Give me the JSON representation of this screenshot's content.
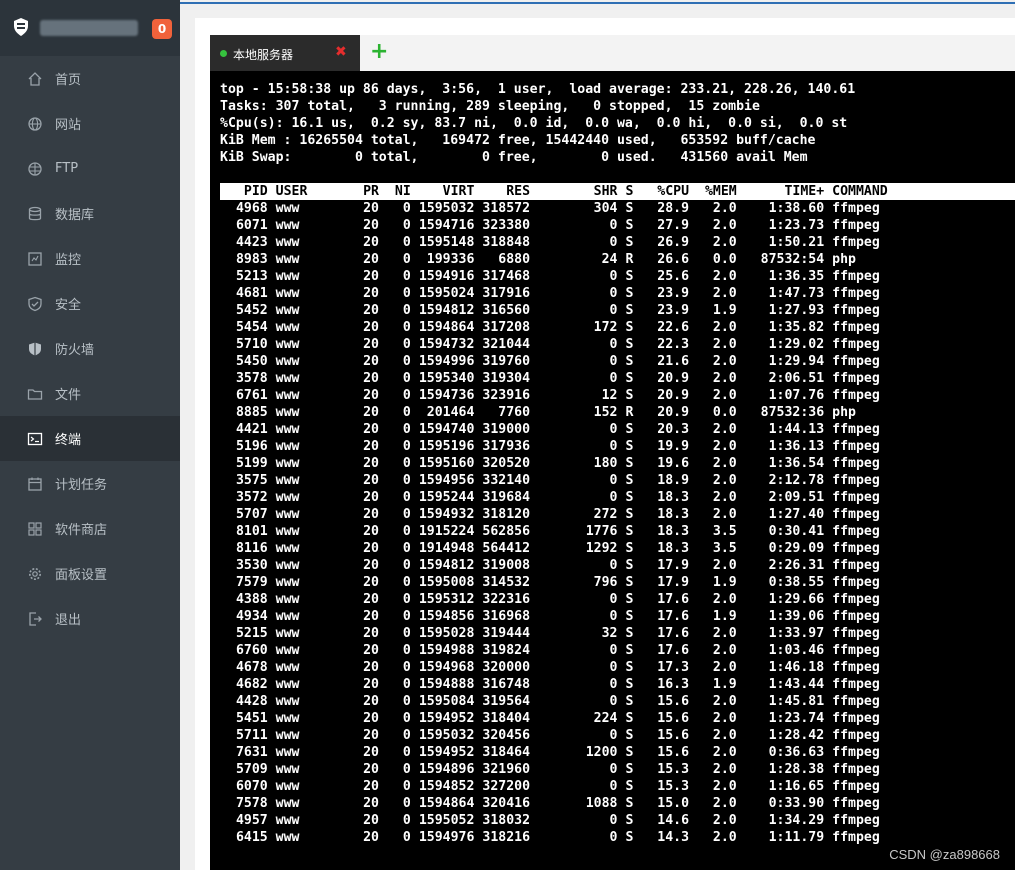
{
  "sidebar": {
    "badge": "0",
    "items": [
      {
        "label": "首页",
        "icon": "home-icon"
      },
      {
        "label": "网站",
        "icon": "globe-icon"
      },
      {
        "label": "FTP",
        "icon": "ftp-globe-icon"
      },
      {
        "label": "数据库",
        "icon": "database-icon"
      },
      {
        "label": "监控",
        "icon": "monitor-icon"
      },
      {
        "label": "安全",
        "icon": "shield-check-icon"
      },
      {
        "label": "防火墙",
        "icon": "firewall-icon"
      },
      {
        "label": "文件",
        "icon": "folder-icon"
      },
      {
        "label": "终端",
        "icon": "terminal-icon",
        "active": true
      },
      {
        "label": "计划任务",
        "icon": "calendar-icon"
      },
      {
        "label": "软件商店",
        "icon": "apps-icon"
      },
      {
        "label": "面板设置",
        "icon": "gear-icon"
      },
      {
        "label": "退出",
        "icon": "logout-icon"
      }
    ]
  },
  "tabs": {
    "active_label": "本地服务器",
    "close_symbol": "✖",
    "add_symbol": "+"
  },
  "terminal": {
    "summary": [
      "top - 15:58:38 up 86 days,  3:56,  1 user,  load average: 233.21, 228.26, 140.61",
      "Tasks: 307 total,   3 running, 289 sleeping,   0 stopped,  15 zombie",
      "%Cpu(s): 16.1 us,  0.2 sy, 83.7 ni,  0.0 id,  0.0 wa,  0.0 hi,  0.0 si,  0.0 st",
      "KiB Mem : 16265504 total,   169472 free, 15442440 used,   653592 buff/cache",
      "KiB Swap:        0 total,        0 free,        0 used.   431560 avail Mem"
    ],
    "columns": [
      "PID",
      "USER",
      "PR",
      "NI",
      "VIRT",
      "RES",
      "SHR",
      "S",
      "%CPU",
      "%MEM",
      "TIME+",
      "COMMAND"
    ],
    "processes": [
      [
        "4968",
        "www",
        "20",
        "0",
        "1595032",
        "318572",
        "304",
        "S",
        "28.9",
        "2.0",
        "1:38.60",
        "ffmpeg"
      ],
      [
        "6071",
        "www",
        "20",
        "0",
        "1594716",
        "323380",
        "0",
        "S",
        "27.9",
        "2.0",
        "1:23.73",
        "ffmpeg"
      ],
      [
        "4423",
        "www",
        "20",
        "0",
        "1595148",
        "318848",
        "0",
        "S",
        "26.9",
        "2.0",
        "1:50.21",
        "ffmpeg"
      ],
      [
        "8983",
        "www",
        "20",
        "0",
        "199336",
        "6880",
        "24",
        "R",
        "26.6",
        "0.0",
        "87532:54",
        "php"
      ],
      [
        "5213",
        "www",
        "20",
        "0",
        "1594916",
        "317468",
        "0",
        "S",
        "25.6",
        "2.0",
        "1:36.35",
        "ffmpeg"
      ],
      [
        "4681",
        "www",
        "20",
        "0",
        "1595024",
        "317916",
        "0",
        "S",
        "23.9",
        "2.0",
        "1:47.73",
        "ffmpeg"
      ],
      [
        "5452",
        "www",
        "20",
        "0",
        "1594812",
        "316560",
        "0",
        "S",
        "23.9",
        "1.9",
        "1:27.93",
        "ffmpeg"
      ],
      [
        "5454",
        "www",
        "20",
        "0",
        "1594864",
        "317208",
        "172",
        "S",
        "22.6",
        "2.0",
        "1:35.82",
        "ffmpeg"
      ],
      [
        "5710",
        "www",
        "20",
        "0",
        "1594732",
        "321044",
        "0",
        "S",
        "22.3",
        "2.0",
        "1:29.02",
        "ffmpeg"
      ],
      [
        "5450",
        "www",
        "20",
        "0",
        "1594996",
        "319760",
        "0",
        "S",
        "21.6",
        "2.0",
        "1:29.94",
        "ffmpeg"
      ],
      [
        "3578",
        "www",
        "20",
        "0",
        "1595340",
        "319304",
        "0",
        "S",
        "20.9",
        "2.0",
        "2:06.51",
        "ffmpeg"
      ],
      [
        "6761",
        "www",
        "20",
        "0",
        "1594736",
        "323916",
        "12",
        "S",
        "20.9",
        "2.0",
        "1:07.76",
        "ffmpeg"
      ],
      [
        "8885",
        "www",
        "20",
        "0",
        "201464",
        "7760",
        "152",
        "R",
        "20.9",
        "0.0",
        "87532:36",
        "php"
      ],
      [
        "4421",
        "www",
        "20",
        "0",
        "1594740",
        "319000",
        "0",
        "S",
        "20.3",
        "2.0",
        "1:44.13",
        "ffmpeg"
      ],
      [
        "5196",
        "www",
        "20",
        "0",
        "1595196",
        "317936",
        "0",
        "S",
        "19.9",
        "2.0",
        "1:36.13",
        "ffmpeg"
      ],
      [
        "5199",
        "www",
        "20",
        "0",
        "1595160",
        "320520",
        "180",
        "S",
        "19.6",
        "2.0",
        "1:36.54",
        "ffmpeg"
      ],
      [
        "3575",
        "www",
        "20",
        "0",
        "1594956",
        "332140",
        "0",
        "S",
        "18.9",
        "2.0",
        "2:12.78",
        "ffmpeg"
      ],
      [
        "3572",
        "www",
        "20",
        "0",
        "1595244",
        "319684",
        "0",
        "S",
        "18.3",
        "2.0",
        "2:09.51",
        "ffmpeg"
      ],
      [
        "5707",
        "www",
        "20",
        "0",
        "1594932",
        "318120",
        "272",
        "S",
        "18.3",
        "2.0",
        "1:27.40",
        "ffmpeg"
      ],
      [
        "8101",
        "www",
        "20",
        "0",
        "1915224",
        "562856",
        "1776",
        "S",
        "18.3",
        "3.5",
        "0:30.41",
        "ffmpeg"
      ],
      [
        "8116",
        "www",
        "20",
        "0",
        "1914948",
        "564412",
        "1292",
        "S",
        "18.3",
        "3.5",
        "0:29.09",
        "ffmpeg"
      ],
      [
        "3530",
        "www",
        "20",
        "0",
        "1594812",
        "319008",
        "0",
        "S",
        "17.9",
        "2.0",
        "2:26.31",
        "ffmpeg"
      ],
      [
        "7579",
        "www",
        "20",
        "0",
        "1595008",
        "314532",
        "796",
        "S",
        "17.9",
        "1.9",
        "0:38.55",
        "ffmpeg"
      ],
      [
        "4388",
        "www",
        "20",
        "0",
        "1595312",
        "322316",
        "0",
        "S",
        "17.6",
        "2.0",
        "1:29.66",
        "ffmpeg"
      ],
      [
        "4934",
        "www",
        "20",
        "0",
        "1594856",
        "316968",
        "0",
        "S",
        "17.6",
        "1.9",
        "1:39.06",
        "ffmpeg"
      ],
      [
        "5215",
        "www",
        "20",
        "0",
        "1595028",
        "319444",
        "32",
        "S",
        "17.6",
        "2.0",
        "1:33.97",
        "ffmpeg"
      ],
      [
        "6760",
        "www",
        "20",
        "0",
        "1594988",
        "319824",
        "0",
        "S",
        "17.6",
        "2.0",
        "1:03.46",
        "ffmpeg"
      ],
      [
        "4678",
        "www",
        "20",
        "0",
        "1594968",
        "320000",
        "0",
        "S",
        "17.3",
        "2.0",
        "1:46.18",
        "ffmpeg"
      ],
      [
        "4682",
        "www",
        "20",
        "0",
        "1594888",
        "316748",
        "0",
        "S",
        "16.3",
        "1.9",
        "1:43.44",
        "ffmpeg"
      ],
      [
        "4428",
        "www",
        "20",
        "0",
        "1595084",
        "319564",
        "0",
        "S",
        "15.6",
        "2.0",
        "1:45.81",
        "ffmpeg"
      ],
      [
        "5451",
        "www",
        "20",
        "0",
        "1594952",
        "318404",
        "224",
        "S",
        "15.6",
        "2.0",
        "1:23.74",
        "ffmpeg"
      ],
      [
        "5711",
        "www",
        "20",
        "0",
        "1595032",
        "320456",
        "0",
        "S",
        "15.6",
        "2.0",
        "1:28.42",
        "ffmpeg"
      ],
      [
        "7631",
        "www",
        "20",
        "0",
        "1594952",
        "318464",
        "1200",
        "S",
        "15.6",
        "2.0",
        "0:36.63",
        "ffmpeg"
      ],
      [
        "5709",
        "www",
        "20",
        "0",
        "1594896",
        "321960",
        "0",
        "S",
        "15.3",
        "2.0",
        "1:28.38",
        "ffmpeg"
      ],
      [
        "6070",
        "www",
        "20",
        "0",
        "1594852",
        "327200",
        "0",
        "S",
        "15.3",
        "2.0",
        "1:16.65",
        "ffmpeg"
      ],
      [
        "7578",
        "www",
        "20",
        "0",
        "1594864",
        "320416",
        "1088",
        "S",
        "15.0",
        "2.0",
        "0:33.90",
        "ffmpeg"
      ],
      [
        "4957",
        "www",
        "20",
        "0",
        "1595052",
        "318032",
        "0",
        "S",
        "14.6",
        "2.0",
        "1:34.29",
        "ffmpeg"
      ],
      [
        "6415",
        "www",
        "20",
        "0",
        "1594976",
        "318216",
        "0",
        "S",
        "14.3",
        "2.0",
        "1:11.79",
        "ffmpeg"
      ]
    ]
  },
  "watermark": "CSDN @za898668",
  "colors": {
    "sidebar_bg": "#353d44",
    "terminal_bg": "#000000",
    "badge": "#f0623b",
    "tab_dot": "#36c23e",
    "tab_close": "#e52d2d",
    "tab_add": "#2bb331"
  }
}
